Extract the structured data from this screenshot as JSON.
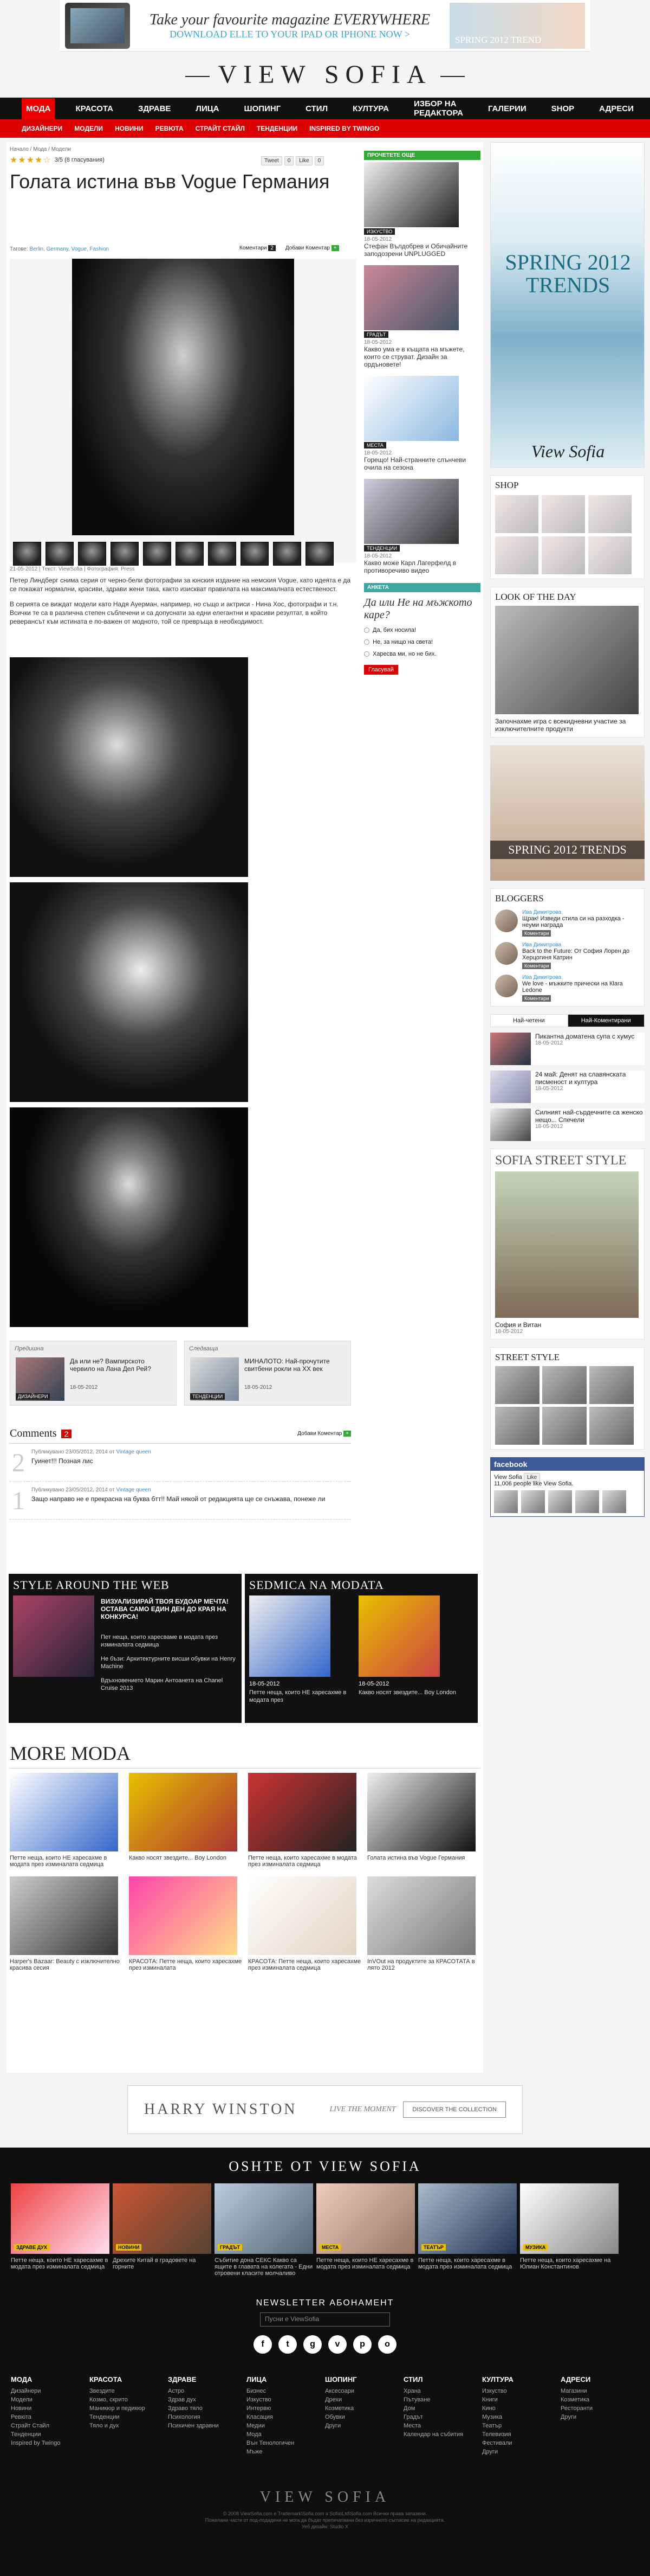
{
  "top_banner": {
    "line1": "Take your favourite magazine EVERYWHERE",
    "line2": "DOWNLOAD ELLE TO YOUR IPAD OR IPHONE NOW >",
    "right_text": "SPRING 2012 TREND"
  },
  "logo": "VIEW SOFIA",
  "nav_main": [
    "МОДА",
    "КРАСОТА",
    "ЗДРАВЕ",
    "ЛИЦА",
    "ШОПИНГ",
    "СТИЛ",
    "КУЛТУРА",
    "ИЗБОР НА РЕДАКТОРА",
    "ГАЛЕРИИ",
    "SHOP",
    "АДРЕСИ"
  ],
  "nav_sub": [
    "ДИЗАЙНЕРИ",
    "МОДЕЛИ",
    "НОВИНИ",
    "РЕВЮТА",
    "СТРАЙТ СТАЙЛ",
    "ТЕНДЕНЦИИ",
    "INSPIRED BY TWINGO"
  ],
  "article": {
    "breadcrumb": "Начало / Мода / Модели",
    "stars": "★★★★☆",
    "rating_text": "3/5 (8 гласувания)",
    "share": [
      "Tweet",
      "0",
      "Like",
      "0"
    ],
    "title": "Голата истина във Vogue Германия",
    "comments_label": "Коментари",
    "comments_count": "2",
    "add_comment": "Добави Коментар",
    "tags_label": "Тагове:",
    "tags": "Berlin, Germany, Vogue, Fashion",
    "caption": "21-05-2012 | Текст: ViewSofia | Фотография: Press",
    "p1": "Петер Линдберг снима серия от черно-бели фотографии за юнския издание на немския Vogue, като идеята е да се покажат нормални, красиви, здрави жени така, както изискват правилата на максималната естественост.",
    "p2": "В серията се виждат модели като Надя Ауерман, например, но също и актриси - Нина Хос, фотографи и т.н. Всички те са в различна степен съблечени и са допуснати за едни елегантни и красиви резултат, в който реверансът към истината е по-важен от модното, той се превръща в необходимост."
  },
  "prev": {
    "label": "Предишна",
    "text": "Да или не? Вампирското червило на Лана Дел Рей?",
    "date": "18-05-2012",
    "cat": "ДИЗАЙНЕРИ"
  },
  "next": {
    "label": "Следваща",
    "text": "МИНАЛОТО: Най-прочутите свитбени рокли на XX век",
    "date": "18-05-2012",
    "cat": "ТЕНДЕНЦИИ"
  },
  "comments": {
    "title": "Comments",
    "count": "2",
    "add": "Добави Коментар",
    "items": [
      {
        "num": "2",
        "meta": "Публикувано 23/05/2012, 2014 от",
        "user": "Vintage queen",
        "text": "Гуинет!!! Позная лис"
      },
      {
        "num": "1",
        "meta": "Публикувано 23/05/2012, 2014 от",
        "user": "Vintage queen",
        "text": "Защо направо не е прекрасна на буква бтт!! Май някой от редакцията ще се снъжава, понеже ли"
      }
    ]
  },
  "style_around": {
    "title": "STYLE AROUND THE WEB",
    "headline": "ВИЗУАЛИЗИРАЙ ТВОЯ БУДОАР МЕЧТА! ОСТАВА САМО ЕДИН ДЕН ДО КРАЯ НА КОНКУРСА!",
    "links": [
      "Пет неща, които харесваме в модата през изминалата седмица",
      "Не бъзи: Архитектурните висши обувки на Henry Machine",
      "Вдъхновението Марин Антоанета на Chanel Cruise 2013"
    ]
  },
  "sedmica": {
    "title": "SEDMICA NA MODATA",
    "items": [
      {
        "date": "18-05-2012",
        "text": "Петте неща, които НЕ харесахме в модата през"
      },
      {
        "date": "18-05-2012",
        "text": "Какво носят звездите... Boy London"
      }
    ]
  },
  "more_moda": {
    "title": "MORE MODA",
    "items": [
      {
        "text": "Петте неща, които НЕ харесахме в модата през изминалата седмица",
        "date": ""
      },
      {
        "text": "Какво носят звездите... Boy London",
        "date": ""
      },
      {
        "text": "Петте неща, които харесахме в модата през изминалата седмица",
        "date": ""
      },
      {
        "text": "Голата истина във Vogue Германия",
        "date": ""
      },
      {
        "text": "Harper's Bazaar: Beauty с изключително красива сесия",
        "date": ""
      },
      {
        "text": "КРАСОТА: Петте неща, които харесахме през изминалата",
        "date": ""
      },
      {
        "text": "КРАСОТА: Петте неща, които харесахме през изминалата седмица",
        "date": ""
      },
      {
        "text": "InVOut на продуктите за КРАСОТАТА в лято 2012",
        "date": ""
      }
    ]
  },
  "sidebar": {
    "tag": "ПРОЧЕТЕТЕ ОЩЕ",
    "items": [
      {
        "cat": "ИЗКУСТВО",
        "date": "18-05-2012",
        "text": "Стефан Вълдобрев и Обичайните заподозрени UNPLUGGED"
      },
      {
        "cat": "ГРАДЪТ",
        "date": "18-05-2012",
        "text": "Какво ума е в къщата на мъжете, които се струват. Дизайн за ордъновете!"
      },
      {
        "cat": "МЕСТА",
        "date": "18-05-2012",
        "text": "Горещо! Най-странните слънчеви очила на сезона"
      },
      {
        "cat": "ТЕНДЕНЦИИ",
        "date": "18-05-2012",
        "text": "Какво може Карл Лагерфелд в противоречиво видео"
      }
    ],
    "poll_tag": "АНКЕТА",
    "poll_q": "Да или Не на мъжкото каре?",
    "poll_opts": [
      "Да, бих носила!",
      "Не, за нищо на света!",
      "Харесва ми, но не бих."
    ],
    "vote": "Гласувай"
  },
  "right": {
    "ad_title": "SPRING 2012 TRENDS",
    "ad_logo": "View Sofia",
    "shop": "SHOP",
    "lotd": "LOOK OF THE DAY",
    "lotd_text": "Започнахме игра с всекидневни участие за изключителните продукти",
    "spring_ad": "SPRING 2012 TRENDS",
    "bloggers": "BLOGGERS",
    "blogger_items": [
      {
        "name": "Ива Димитрова",
        "text": "Щрак! Изведи стила си на разходка - неуми награда",
        "btn": "Коментари"
      },
      {
        "name": "Ива Димитрова",
        "text": "Back to the Future: От София Лорен до Херцогиня Катрин",
        "btn": "Коментари"
      },
      {
        "name": "Ива Димитрова",
        "text": "We love - мъжките прически на Кlara Ledone",
        "btn": "Коментари"
      }
    ],
    "tabs": [
      "Най-четени",
      "Най-Коментирани"
    ],
    "mini": [
      {
        "text": "Пикантна доматена супа с хумус",
        "date": "18-05-2012"
      },
      {
        "text": "24 май: Денят на славянската писменост и култура",
        "date": "18-05-2012"
      },
      {
        "text": "Силният най-сърдечните са женско нещо... Спечели",
        "date": "18-05-2012"
      }
    ],
    "sofia_street": "SOFIA STREET STYLE",
    "street_name": "София и Витан",
    "street_date": "18-05-2012",
    "street_style": "STREET STYLE",
    "fb_head": "facebook",
    "fb_page": "View Sofia",
    "fb_count": "11,006 people like View Sofia.",
    "fb_like": "Like"
  },
  "footer_ad": {
    "logo": "HARRY WINSTON",
    "sub": "LIVE THE MOMENT",
    "btn": "DISCOVER THE COLLECTION"
  },
  "footer": {
    "title": "OSHTE OT VIEW SOFIA",
    "cards": [
      {
        "cat": "ЗДРАВЕ ДУХ",
        "text": "Петте неща, които НЕ харесахме в модата през изминалата седмица"
      },
      {
        "cat": "НОВИНИ",
        "text": "Дрехите Китай в градовете на горните"
      },
      {
        "cat": "ГРАДЪТ",
        "text": "Събитие дона СЕКС Какво са ящите в главата на колегата - Едни отровени класите молчаливо"
      },
      {
        "cat": "МЕСТА",
        "text": "Петте неща, които НЕ харесахме в модата през изминалата седмица"
      },
      {
        "cat": "ТЕАТЪР",
        "text": "Петте неща, които харесахме в модата през изминалата седмица"
      },
      {
        "cat": "МУЗИКА",
        "text": "Петте неща, които харесахме на Юлиан Константинов"
      }
    ],
    "nl_title": "NEWSLETTER АБОНАМЕНТ",
    "nl_placeholder": "Пусни е ViewSofia",
    "social": [
      "f",
      "t",
      "g",
      "v",
      "p",
      "o"
    ],
    "cols": [
      {
        "h": "МОДА",
        "items": [
          "Дизайнери",
          "Модели",
          "Новини",
          "Ревюта",
          "Страйт Стайл",
          "Тенденции",
          "Inspired by Twingo"
        ]
      },
      {
        "h": "КРАСОТА",
        "items": [
          "Звездите",
          "Козмо, скрито",
          "Маникюр и педикюр",
          "Тенденции",
          "Тяло и дух"
        ]
      },
      {
        "h": "ЗДРАВЕ",
        "items": [
          "Астро",
          "Здрав дух",
          "Здраво тяло",
          "Психология",
          "Психичен здравни"
        ]
      },
      {
        "h": "ЛИЦА",
        "items": [
          "Бизнес",
          "Изкуство",
          "Интервю",
          "Класация",
          "Медии",
          "Мода",
          "Вън Тенологичен",
          "Мъже"
        ]
      },
      {
        "h": "ШОПИНГ",
        "items": [
          "Аксесоари",
          "Дрехи",
          "Козметика",
          "Обувки",
          "Други"
        ]
      },
      {
        "h": "СТИЛ",
        "items": [
          "Храна",
          "Пътуване",
          "Дом",
          "Градът",
          "Места",
          "Календар на събития"
        ]
      },
      {
        "h": "КУЛТУРА",
        "items": [
          "Изкуство",
          "Книги",
          "Кино",
          "Музика",
          "Театър",
          "Телевизия",
          "Фестивали",
          "Други"
        ]
      },
      {
        "h": "АДРЕСИ",
        "items": [
          "Магазини",
          "Козметика",
          "Ресторанти",
          "Други"
        ]
      }
    ],
    "logo": "VIEW SOFIA",
    "copy1": "© 2008 ViewSofia.com e Trademark\\Sofia.com a Sofia\\Ltd\\Sofia.com Всички права запазени.",
    "copy2": "Пожелани части от под-подадени не мога да бъдат препечатвани без изричното съгласие на редакцията.",
    "copy3": "Уеб дизайн: Studio X"
  }
}
